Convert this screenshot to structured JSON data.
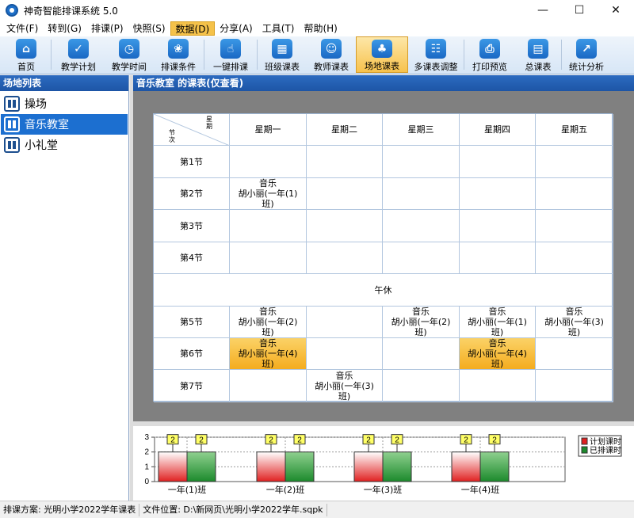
{
  "window": {
    "title": "神奇智能排课系统 5.0",
    "minimize": "—",
    "maximize": "☐",
    "close": "✕"
  },
  "menu": [
    "文件(F)",
    "转到(G)",
    "排课(P)",
    "快照(S)",
    "数据(D)",
    "分享(A)",
    "工具(T)",
    "帮助(H)"
  ],
  "menu_active_index": 4,
  "toolbar": [
    {
      "label": "首页",
      "icon": "home-icon",
      "glyph": "⌂"
    },
    {
      "label": "教学计划",
      "icon": "clipboard-check-icon",
      "glyph": "✓"
    },
    {
      "label": "教学时间",
      "icon": "clock-icon",
      "glyph": "◷"
    },
    {
      "label": "排课条件",
      "icon": "circles-icon",
      "glyph": "❀"
    },
    {
      "label": "一键排课",
      "icon": "hand-pointer-icon",
      "glyph": "☝"
    },
    {
      "label": "班级课表",
      "icon": "calendar-grid-icon",
      "glyph": "▦"
    },
    {
      "label": "教师课表",
      "icon": "teacher-card-icon",
      "glyph": "☺"
    },
    {
      "label": "场地课表",
      "icon": "venue-icon",
      "glyph": "♣"
    },
    {
      "label": "多课表调整",
      "icon": "multi-schedule-icon",
      "glyph": "☷"
    },
    {
      "label": "打印预览",
      "icon": "printer-icon",
      "glyph": "⎙"
    },
    {
      "label": "总课表",
      "icon": "master-calendar-icon",
      "glyph": "▤"
    },
    {
      "label": "统计分析",
      "icon": "chart-icon",
      "glyph": "↗"
    }
  ],
  "toolbar_active_index": 7,
  "left_panel": {
    "title": "场地列表",
    "venues": [
      "操场",
      "音乐教室",
      "小礼堂"
    ],
    "selected_index": 1
  },
  "right_panel": {
    "title": "音乐教室 的课表(仅查看)"
  },
  "schedule": {
    "corner_top": "星期",
    "corner_bottom": "节次",
    "days": [
      "星期一",
      "星期二",
      "星期三",
      "星期四",
      "星期五"
    ],
    "lunch": "午休",
    "periods": [
      {
        "label": "第1节",
        "cells": [
          "",
          "",
          "",
          "",
          ""
        ]
      },
      {
        "label": "第2节",
        "cells": [
          "音乐\n胡小丽(一年(1)\n班)",
          "",
          "",
          "",
          ""
        ]
      },
      {
        "label": "第3节",
        "cells": [
          "",
          "",
          "",
          "",
          ""
        ]
      },
      {
        "label": "第4节",
        "cells": [
          "",
          "",
          "",
          "",
          ""
        ]
      },
      {
        "label": "第5节",
        "cells": [
          "音乐\n胡小丽(一年(2)\n班)",
          "",
          "音乐\n胡小丽(一年(2)\n班)",
          "音乐\n胡小丽(一年(1)\n班)",
          "音乐\n胡小丽(一年(3)\n班)"
        ]
      },
      {
        "label": "第6节",
        "cells": [
          "音乐\n胡小丽(一年(4)\n班)",
          "",
          "",
          "音乐\n胡小丽(一年(4)\n班)",
          ""
        ]
      },
      {
        "label": "第7节",
        "cells": [
          "",
          "音乐\n胡小丽(一年(3)\n班)",
          "",
          "",
          ""
        ]
      }
    ],
    "highlighted": [
      [
        5,
        0
      ],
      [
        5,
        3
      ]
    ]
  },
  "chart_data": {
    "type": "bar",
    "categories": [
      "一年(1)班",
      "一年(2)班",
      "一年(3)班",
      "一年(4)班"
    ],
    "series": [
      {
        "name": "计划课时",
        "values": [
          2,
          2,
          2,
          2
        ],
        "color": "#e02020"
      },
      {
        "name": "已排课时",
        "values": [
          2,
          2,
          2,
          2
        ],
        "color": "#1c8a2c"
      }
    ],
    "yticks": [
      "0",
      "1",
      "2",
      "3"
    ],
    "ylim": [
      0,
      3
    ],
    "data_labels": [
      "2",
      "2",
      "2",
      "2",
      "2",
      "2",
      "2",
      "2"
    ],
    "grid": true,
    "legend": "right"
  },
  "status": {
    "plan_label": "排课方案: ",
    "plan_value": "光明小学2022学年课表",
    "file_label": "文件位置: ",
    "file_value": "D:\\新网页\\光明小学2022学年.sqpk"
  }
}
